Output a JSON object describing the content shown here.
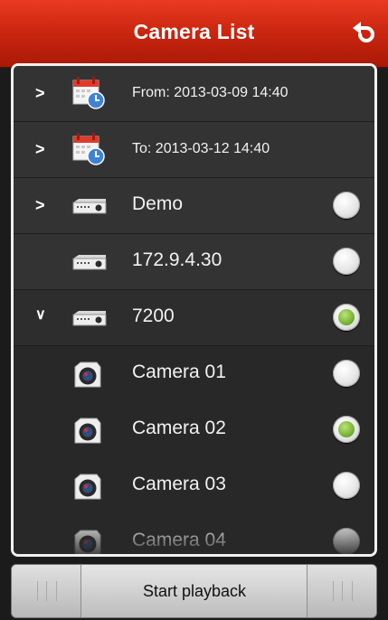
{
  "header": {
    "title": "Camera List",
    "refresh_icon": "refresh-icon"
  },
  "list": {
    "time_rows": [
      {
        "label": "From: 2013-03-09  14:40",
        "icon": "calendar-clock-icon"
      },
      {
        "label": "To: 2013-03-12  14:40",
        "icon": "calendar-clock-icon"
      }
    ],
    "devices": [
      {
        "label": "Demo",
        "icon": "dvr-device-icon",
        "expandable": true,
        "expanded": false,
        "selected": false
      },
      {
        "label": "172.9.4.30",
        "icon": "dvr-device-icon",
        "expandable": false,
        "expanded": false,
        "selected": false
      },
      {
        "label": "7200",
        "icon": "dvr-device-icon",
        "expandable": true,
        "expanded": true,
        "selected": true
      }
    ],
    "cameras": [
      {
        "label": "Camera 01",
        "icon": "camera-icon",
        "selected": false
      },
      {
        "label": "Camera 02",
        "icon": "camera-icon",
        "selected": true
      },
      {
        "label": "Camera 03",
        "icon": "camera-icon",
        "selected": false
      },
      {
        "label": "Camera 04",
        "icon": "camera-icon",
        "selected": false
      }
    ]
  },
  "bottom_bar": {
    "start_label": "Start playback"
  },
  "colors": {
    "header_red": "#c9250f",
    "selected_green": "#79b435"
  }
}
